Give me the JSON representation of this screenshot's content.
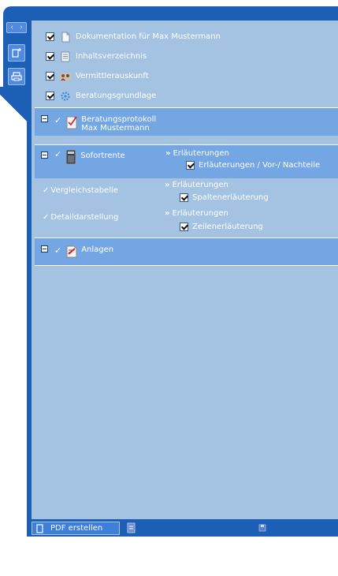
{
  "top_items": [
    {
      "label": "Dokumentation für Max Mustermann",
      "icon": "document-icon"
    },
    {
      "label": "Inhaltsverzeichnis",
      "icon": "list-icon"
    },
    {
      "label": "Vermittlerauskunft",
      "icon": "people-icon"
    },
    {
      "label": "Beratungsgrundlage",
      "icon": "gears-icon"
    }
  ],
  "section_beratungsprotokoll": {
    "title": "Beratungsprotokoll",
    "subtitle": "Max Mustermann"
  },
  "section_sofortrente": {
    "title": "Sofortrente",
    "erlaeuterungen": "Erläuterungen",
    "option": "Erläuterungen / Vor-/ Nachteile"
  },
  "vergleichstabelle": {
    "label": "Vergleichstabelle",
    "erlaeuterungen": "Erläuterungen",
    "option": "Spaltenerläuterung"
  },
  "detaildarstellung": {
    "label": "Detaildarstellung",
    "erlaeuterungen": "Erläuterungen",
    "option": "Zeilenerläuterung"
  },
  "section_anlagen": {
    "title": "Anlagen"
  },
  "bottom": {
    "pdf_label": "PDF erstellen"
  },
  "colors": {
    "sidebar": "#1c5fb4",
    "panel": "#a4c2e2",
    "section": "#74a6e4"
  }
}
